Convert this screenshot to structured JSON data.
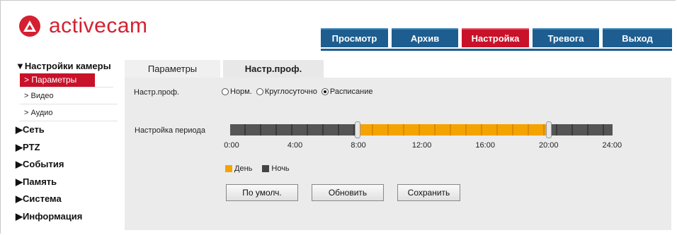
{
  "brand": {
    "logo_text": "activecam",
    "color": "#d42030"
  },
  "top_nav": {
    "items": [
      {
        "label": "Просмотр",
        "active": false
      },
      {
        "label": "Архив",
        "active": false
      },
      {
        "label": "Настройка",
        "active": true
      },
      {
        "label": "Тревога",
        "active": false
      },
      {
        "label": "Выход",
        "active": false
      }
    ],
    "color": "#1d5d8f",
    "active_color": "#c9112a"
  },
  "sidebar": {
    "section_title": "▼Настройки камеры",
    "sub_items": [
      {
        "label": "> Параметры",
        "active": true
      },
      {
        "label": "> Видео",
        "active": false
      },
      {
        "label": "> Аудио",
        "active": false
      }
    ],
    "items": [
      "▶Сеть",
      "▶PTZ",
      "▶События",
      "▶Память",
      "▶Система",
      "▶Информация"
    ]
  },
  "content_tabs": [
    {
      "label": "Параметры",
      "active": false
    },
    {
      "label": "Настр.проф.",
      "active": true
    }
  ],
  "profile": {
    "label": "Настр.проф.",
    "options": [
      {
        "label": "Норм.",
        "checked": false
      },
      {
        "label": "Круглосуточно",
        "checked": false
      },
      {
        "label": "Расписание",
        "checked": true
      }
    ]
  },
  "schedule": {
    "label": "Настройка периода",
    "range_hours": [
      0,
      24
    ],
    "day_start": "8:00",
    "day_end": "20:00",
    "day_start_h": 8,
    "day_end_h": 20,
    "ticks": [
      "0:00",
      "4:00",
      "8:00",
      "12:00",
      "16:00",
      "20:00",
      "24:00"
    ],
    "legend": [
      {
        "label": "День",
        "color": "#f5a300"
      },
      {
        "label": "Ночь",
        "color": "#444444"
      }
    ]
  },
  "buttons": {
    "default": "По умолч.",
    "refresh": "Обновить",
    "save": "Сохранить"
  }
}
